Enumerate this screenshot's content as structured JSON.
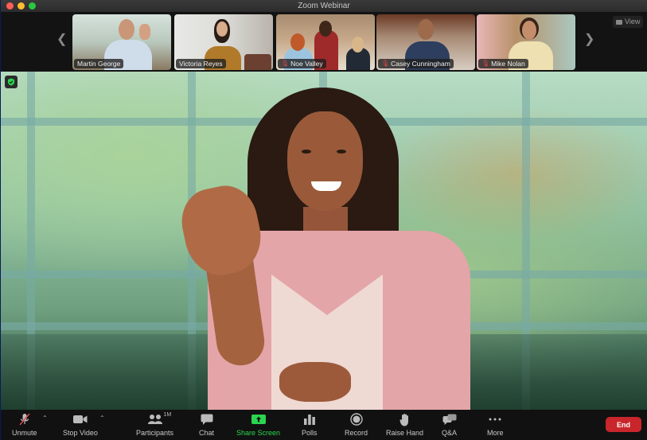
{
  "window": {
    "title": "Zoom Webinar"
  },
  "gallery": {
    "prev_icon": "chevron-left-icon",
    "next_icon": "chevron-right-icon",
    "view_label": "View",
    "participants": [
      {
        "name": "Martin George",
        "muted": false,
        "active": false
      },
      {
        "name": "Victoria Reyes",
        "muted": false,
        "active": true
      },
      {
        "name": "Noe Valley",
        "muted": true,
        "active": false
      },
      {
        "name": "Casey Cunningham",
        "muted": true,
        "active": false
      },
      {
        "name": "Mike Nolan",
        "muted": true,
        "active": false
      }
    ]
  },
  "main_video": {
    "security_icon": "shield-check-icon",
    "security_color": "#2bd54f"
  },
  "toolbar": {
    "unmute": "Unmute",
    "stop_video": "Stop Video",
    "participants": "Participants",
    "participants_count": "1M",
    "chat": "Chat",
    "share_screen": "Share Screen",
    "polls": "Polls",
    "record": "Record",
    "raise_hand": "Raise Hand",
    "qa": "Q&A",
    "more": "More",
    "end": "End"
  },
  "colors": {
    "accent_green": "#2bd54f",
    "end_red": "#c8262b",
    "muted_red": "#e0454a"
  }
}
